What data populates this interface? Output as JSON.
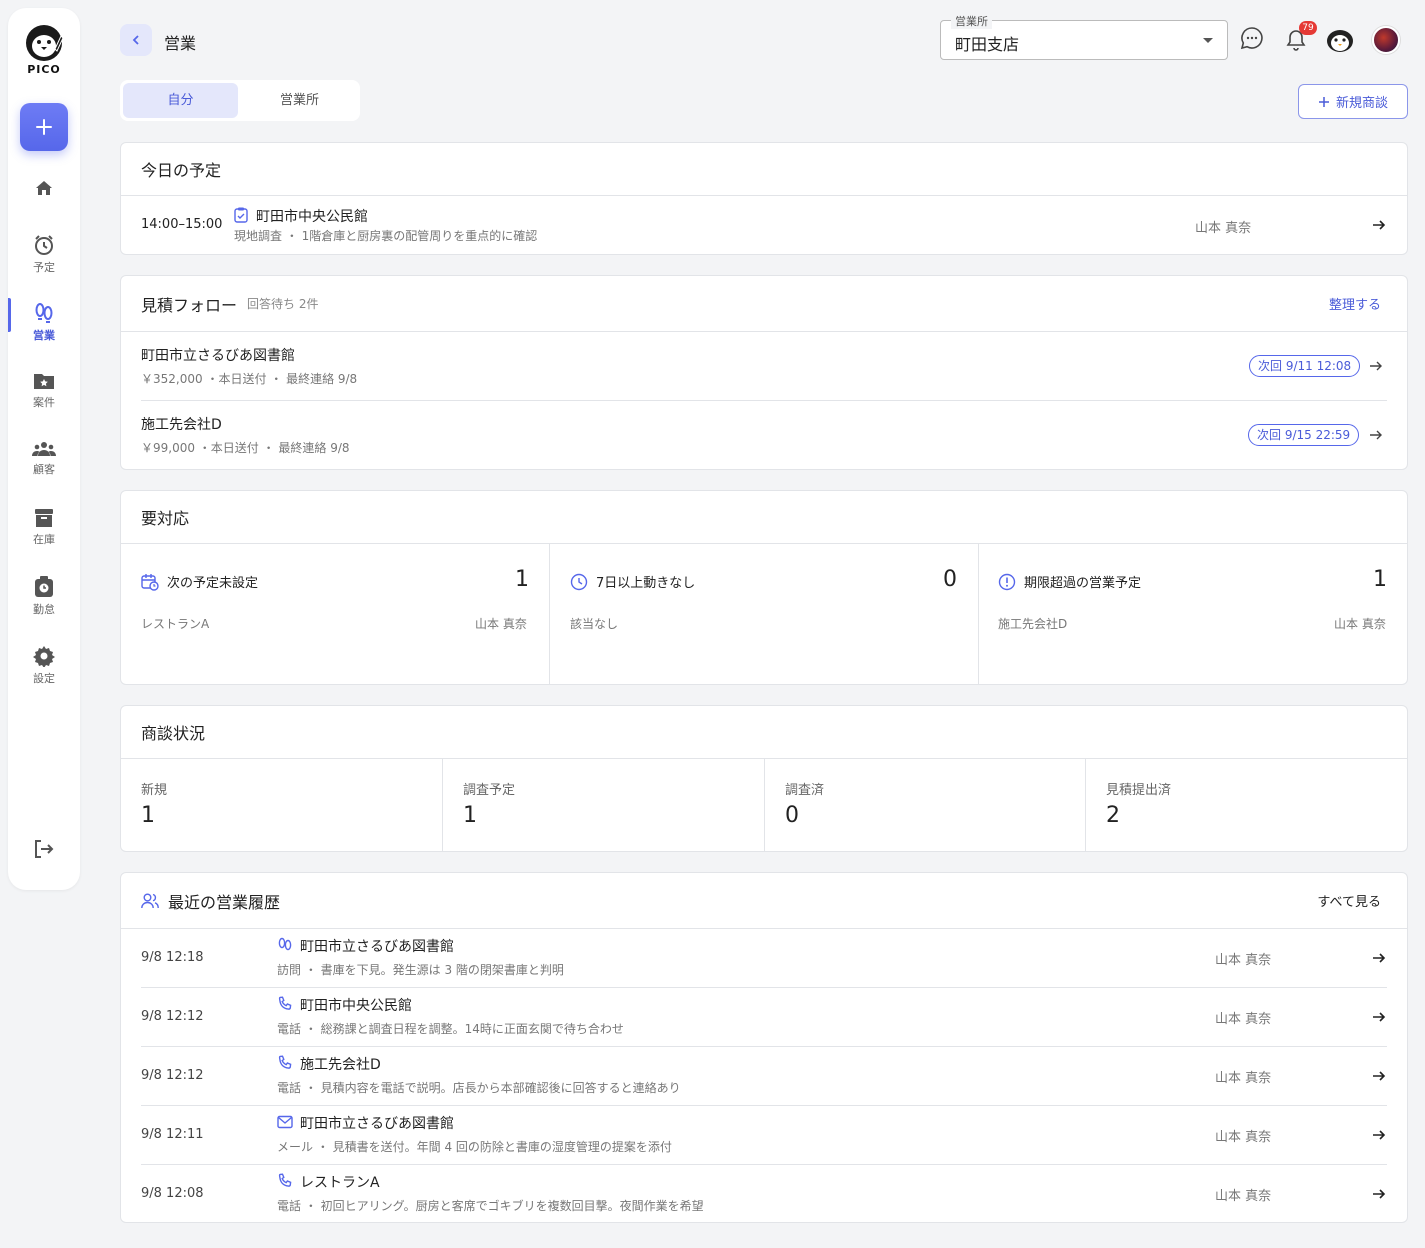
{
  "app": {
    "logo_text": "PICO"
  },
  "sidebar": {
    "items": [
      {
        "label": "",
        "icon": "home-icon"
      },
      {
        "label": "予定",
        "icon": "alarm-clock-icon"
      },
      {
        "label": "営業",
        "icon": "footprints-icon"
      },
      {
        "label": "案件",
        "icon": "folder-star-icon"
      },
      {
        "label": "顧客",
        "icon": "people-icon"
      },
      {
        "label": "在庫",
        "icon": "archive-icon"
      },
      {
        "label": "勤怠",
        "icon": "timecard-icon"
      },
      {
        "label": "設定",
        "icon": "gear-icon"
      }
    ],
    "active": "営業"
  },
  "header": {
    "title": "営業",
    "branch_label": "営業所",
    "branch_value": "町田支店",
    "notification_count": "79"
  },
  "toggle": {
    "mine": "自分",
    "office": "営業所"
  },
  "new_button": "新規商談",
  "today": {
    "title": "今日の予定",
    "items": [
      {
        "time": "14:00–15:00",
        "place": "町田市中央公民館",
        "detail": "現地調査 ・ 1階倉庫と厨房裏の配管周りを重点的に確認",
        "person": "山本 真奈"
      }
    ]
  },
  "estimates": {
    "title": "見積フォロー",
    "subtitle": "回答待ち 2件",
    "action": "整理する",
    "items": [
      {
        "name": "町田市立さるびあ図書館",
        "detail": "￥352,000 ・本日送付 ・ 最終連絡 9/8",
        "next": "次回 9/11 12:08"
      },
      {
        "name": "施工先会社D",
        "detail": "￥99,000 ・本日送付 ・ 最終連絡 9/8",
        "next": "次回 9/15 22:59"
      }
    ]
  },
  "action_needed": {
    "title": "要対応",
    "panels": [
      {
        "title": "次の予定未設定",
        "count": "1",
        "left": "レストランA",
        "right": "山本 真奈",
        "icon": "calendar-clock-icon"
      },
      {
        "title": "7日以上動きなし",
        "count": "0",
        "left": "該当なし",
        "right": "",
        "icon": "clock-icon"
      },
      {
        "title": "期限超過の営業予定",
        "count": "1",
        "left": "施工先会社D",
        "right": "山本 真奈",
        "icon": "alert-circle-icon"
      }
    ]
  },
  "deal_status": {
    "title": "商談状況",
    "stages": [
      {
        "label": "新規",
        "count": "1"
      },
      {
        "label": "調査予定",
        "count": "1"
      },
      {
        "label": "調査済",
        "count": "0"
      },
      {
        "label": "見積提出済",
        "count": "2"
      }
    ]
  },
  "history": {
    "title": "最近の営業履歴",
    "action": "すべて見る",
    "items": [
      {
        "time": "9/8 12:18",
        "name": "町田市立さるびあ図書館",
        "detail": "訪問 ・ 書庫を下見。発生源は 3 階の閉架書庫と判明",
        "person": "山本 真奈",
        "icon": "footprints-icon"
      },
      {
        "time": "9/8 12:12",
        "name": "町田市中央公民館",
        "detail": "電話 ・ 総務課と調査日程を調整。14時に正面玄関で待ち合わせ",
        "person": "山本 真奈",
        "icon": "phone-icon"
      },
      {
        "time": "9/8 12:12",
        "name": "施工先会社D",
        "detail": "電話 ・ 見積内容を電話で説明。店長から本部確認後に回答すると連絡あり",
        "person": "山本 真奈",
        "icon": "phone-icon"
      },
      {
        "time": "9/8 12:11",
        "name": "町田市立さるびあ図書館",
        "detail": "メール ・ 見積書を送付。年間 4 回の防除と書庫の湿度管理の提案を添付",
        "person": "山本 真奈",
        "icon": "mail-icon"
      },
      {
        "time": "9/8 12:08",
        "name": "レストランA",
        "detail": "電話 ・ 初回ヒアリング。厨房と客席でゴキブリを複数回目撃。夜間作業を希望",
        "person": "山本 真奈",
        "icon": "phone-icon"
      }
    ]
  },
  "colors": {
    "accent": "#5667ea",
    "accent_light": "#e4e7fb",
    "badge": "#e53935"
  }
}
